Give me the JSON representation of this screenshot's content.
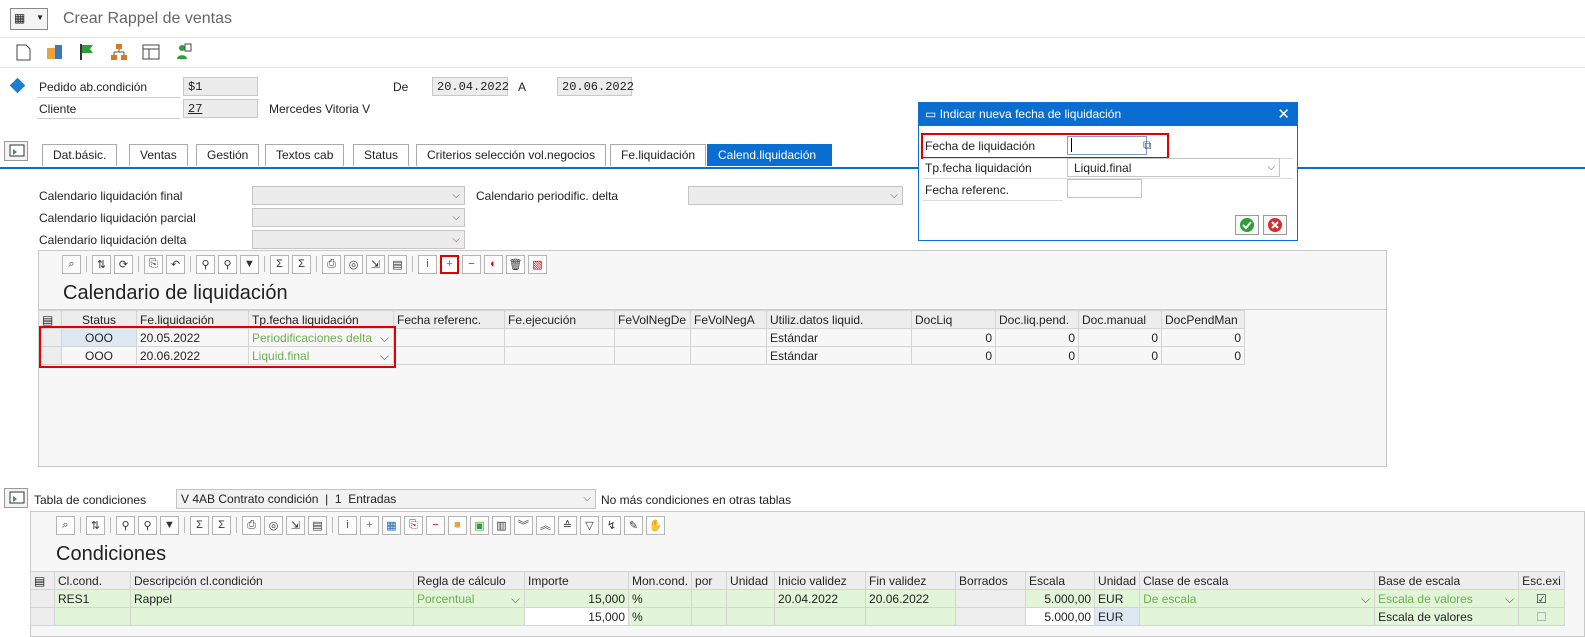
{
  "window": {
    "title": "Crear Rappel de ventas"
  },
  "header": {
    "pedido_label": "Pedido ab.condición",
    "pedido_value": "$1",
    "cliente_label": "Cliente",
    "cliente_value": "27",
    "cliente_name": "Mercedes Vitoria V",
    "de_label": "De",
    "de_value": "20.04.2022",
    "a_label": "A",
    "a_value": "20.06.2022"
  },
  "tabs": [
    "Dat.básic.",
    "Ventas",
    "Gestión",
    "Textos cab",
    "Status",
    "Criterios selección vol.negocios",
    "Fe.liquidación",
    "Calend.liquidación"
  ],
  "active_tab": "Calend.liquidación",
  "calendars": {
    "final_label": "Calendario liquidación final",
    "parcial_label": "Calendario liquidación parcial",
    "delta_label": "Calendario liquidación delta",
    "periodific_label": "Calendario periodific. delta"
  },
  "liq_grid": {
    "title": "Calendario de liquidación",
    "columns": [
      "Status",
      "Fe.liquidación",
      "Tp.fecha liquidación",
      "Fecha referenc.",
      "Fe.ejecución",
      "FeVolNegDe",
      "FeVolNegA",
      "Utiliz.datos liquid.",
      "DocLiq",
      "Doc.liq.pend.",
      "Doc.manual",
      "DocPendMan"
    ],
    "rows": [
      {
        "status": "OOO",
        "fecha": "20.05.2022",
        "tipo": "Periodificaciones delta",
        "util": "Estándar",
        "docliq": "0",
        "docpend": "0",
        "docman": "0",
        "docpendman": "0"
      },
      {
        "status": "OOO",
        "fecha": "20.06.2022",
        "tipo": "Liquid.final",
        "util": "Estándar",
        "docliq": "0",
        "docpend": "0",
        "docman": "0",
        "docpendman": "0"
      }
    ]
  },
  "cond_table": {
    "label": "Tabla de condiciones",
    "value": "V 4AB Contrato condición  |  1  Entradas",
    "note": "No más condiciones en otras tablas"
  },
  "cond_grid": {
    "title": "Condiciones",
    "columns": [
      "Cl.cond.",
      "Descripción cl.condición",
      "Regla de cálculo",
      "Importe",
      "Mon.cond.",
      "por",
      "Unidad",
      "Inicio validez",
      "Fin validez",
      "Borrados",
      "Escala",
      "Unidad",
      "Clase de escala",
      "Base de escala",
      "Esc.exi"
    ],
    "rows": [
      {
        "clcond": "RES1",
        "desc": "Rappel",
        "regla": "Porcentual",
        "importe": "15,000",
        "mon": "%",
        "inicio": "20.04.2022",
        "fin": "20.06.2022",
        "escala": "5.000,00",
        "unidad": "EUR",
        "clase": "De escala",
        "base": "Escala de valores"
      },
      {
        "clcond": "",
        "desc": "",
        "regla": "",
        "importe": "15,000",
        "mon": "%",
        "inicio": "",
        "fin": "",
        "escala": "5.000,00",
        "unidad": "EUR",
        "clase": "",
        "base": "Escala de valores"
      }
    ]
  },
  "dialog": {
    "title": "Indicar nueva fecha de liquidación",
    "fecha_label": "Fecha de liquidación",
    "tipo_label": "Tp.fecha liquidación",
    "tipo_value": "Liquid.final",
    "ref_label": "Fecha referenc."
  },
  "colors": {
    "accent": "#0a6ed1",
    "highlight": "#e00000",
    "green_row": "#e2f5d9"
  }
}
